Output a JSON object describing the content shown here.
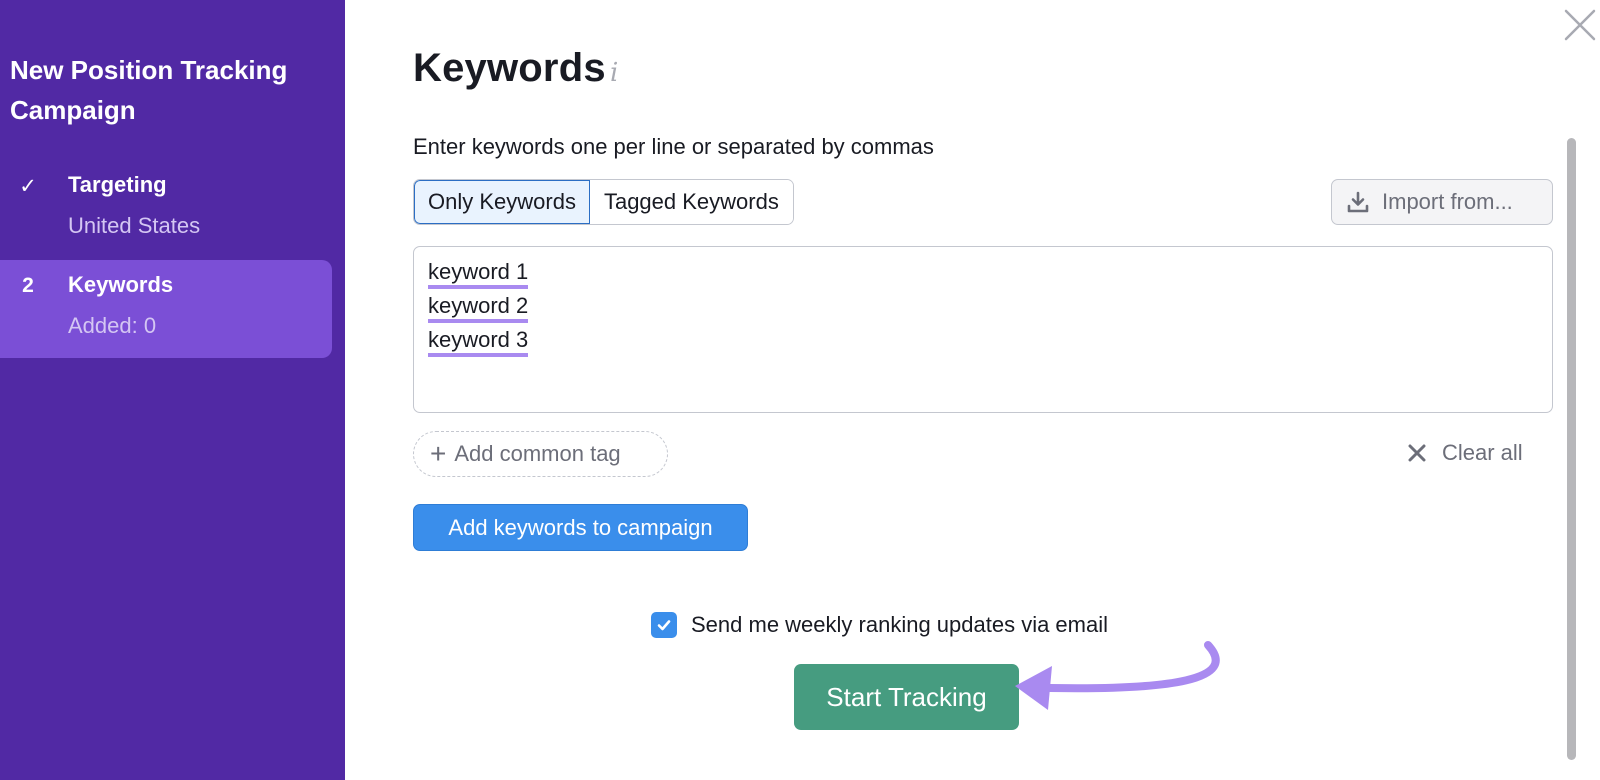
{
  "sidebar": {
    "title": "New Position Tracking Campaign",
    "steps": [
      {
        "marker": "✓",
        "label": "Targeting",
        "sub": "United States",
        "state": "done"
      },
      {
        "marker": "2",
        "label": "Keywords",
        "sub": "Added: 0",
        "state": "active"
      }
    ]
  },
  "main": {
    "title": "Keywords",
    "info_icon": "i",
    "hint": "Enter keywords one per line or separated by commas",
    "tabs": [
      {
        "label": "Only Keywords",
        "selected": true
      },
      {
        "label": "Tagged Keywords",
        "selected": false
      }
    ],
    "import_label": "Import from...",
    "keywords": [
      "keyword 1",
      "keyword 2",
      "keyword 3"
    ],
    "add_tag_label": "Add common tag",
    "clear_all_label": "Clear all",
    "add_keywords_label": "Add keywords to campaign",
    "email_checkbox": {
      "label": "Send me weekly ranking updates via email",
      "checked": true
    },
    "start_label": "Start Tracking"
  },
  "colors": {
    "sidebar_bg": "#5129a4",
    "sidebar_active": "#7b4fd6",
    "primary_blue": "#3a8eeb",
    "start_green": "#469c80",
    "annotation_purple": "#a98af0"
  }
}
